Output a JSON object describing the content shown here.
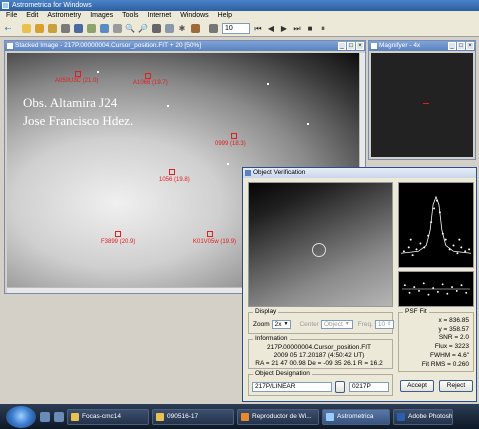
{
  "window": {
    "title": "Astrometrica for Windows"
  },
  "menu": [
    "File",
    "Edit",
    "Astrometry",
    "Images",
    "Tools",
    "Internet",
    "Windows",
    "Help"
  ],
  "toolbar": {
    "number_value": "10"
  },
  "stacked_image": {
    "title": "Stacked Image - 217P.00000004.Cursor_position.FIT + 20 [50%]",
    "overlay_line1": "Obs. Altamira J24",
    "overlay_line2": "Jose Francisco Hdez.",
    "markers": [
      {
        "label": "A050U3C (21.0)"
      },
      {
        "label": "A1066 (19.7)"
      },
      {
        "label": "0999 (18.3)"
      },
      {
        "label": "1056 (19.8)"
      },
      {
        "label": "F3899 (20.9)"
      },
      {
        "label": "K01V05w (19.9)"
      }
    ]
  },
  "magnifier": {
    "title": "Magnifyer - 4x"
  },
  "verification": {
    "title": "Object Verification",
    "display": {
      "group_label": "Display",
      "zoom_label": "Zoom",
      "zoom_value": "2x",
      "center_label": "Center",
      "center_value": "Object",
      "freq_label": "Freq.",
      "freq_value": "10"
    },
    "information": {
      "group_label": "Information",
      "line1": "217P.00000004.Cursor_position.FIT",
      "line2": "2009 05 17.20187 (4:50:42 UT)",
      "line3": "RA = 21 47 00.98   De = -09 35 26.1   R = 16.2"
    },
    "designation": {
      "group_label": "Object Designation",
      "select_value": "217P/LINEAR",
      "field_value": "0217P"
    },
    "psf_fit": {
      "group_label": "PSF Fit",
      "x": "x = 836.85",
      "y": "y = 358.57",
      "snr": "SNR = 2.0",
      "flux": "Flux = 3223",
      "fwhm": "FWHM = 4.6\"",
      "fit_rms": "Fit RMS = 0.260"
    },
    "accept_label": "Accept",
    "reject_label": "Reject"
  },
  "taskbar": {
    "items": [
      {
        "label": "Focas-cmc14"
      },
      {
        "label": "090516-17"
      },
      {
        "label": "Reproductor de Wi..."
      },
      {
        "label": "Astrometrica"
      },
      {
        "label": "Adobe Photosh"
      }
    ]
  }
}
